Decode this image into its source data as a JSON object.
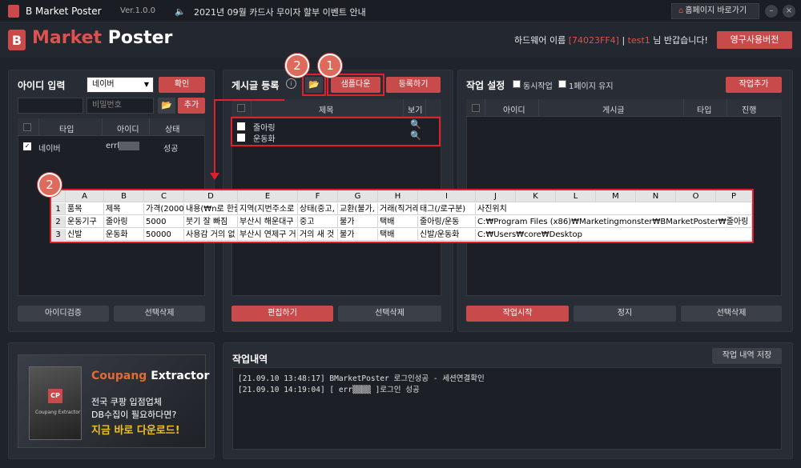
{
  "titlebar": {
    "app_name": "B Market Poster",
    "version": "Ver.1.0.0",
    "notice": "2021년 09월 카드사 무이자 할부 이벤트 안내",
    "home_button": "홈페이지 바로가기"
  },
  "header": {
    "logo_b": "B",
    "logo_market": "Market",
    "logo_poster": "Poster",
    "hw_label": "하드웨어 이름 ",
    "hw_value": "[74023FF4]",
    "sep": " | ",
    "user": "test1",
    "welcome": " 님 반갑습니다!",
    "license_button": "영구사용버전"
  },
  "account": {
    "title": "아이디 입력",
    "site_select": "네이버",
    "confirm_button": "확인",
    "password_placeholder": "비밀번호",
    "add_button": "추가",
    "columns": [
      "타입",
      "아이디",
      "상태"
    ],
    "rows": [
      {
        "type": "네이버",
        "id": "errl",
        "status": "성공"
      }
    ],
    "verify_button": "아이디검증",
    "delete_button": "선택삭제"
  },
  "posts": {
    "title": "게시글 등록",
    "sample_button": "샘플다운",
    "register_button": "등록하기",
    "columns": [
      "제목",
      "보기"
    ],
    "rows": [
      {
        "title": "줄아링"
      },
      {
        "title": "운동화"
      }
    ],
    "edit_button": "편집하기",
    "delete_button": "선택삭제"
  },
  "jobs": {
    "title": "작업 설정",
    "opt_concurrent": "동시작업",
    "opt_keep_page": "1페이지 유지",
    "add_button": "작업추가",
    "columns": [
      "아이디",
      "게시글",
      "타입",
      "진행"
    ],
    "start_button": "작업시작",
    "stop_button": "정지",
    "delete_button": "선택삭제"
  },
  "history": {
    "title": "작업내역",
    "save_button": "작업 내역 저장",
    "lines": [
      "[21.09.10 13:48:17]  BMarketPoster 로그인성공 - 세션연결확인",
      "[21.09.10 14:19:04]  [ err▒▒▒▒ ]로그인 성공"
    ]
  },
  "banner": {
    "brand_coupang": "Coupang",
    "brand_extractor": " Extractor",
    "line1": "전국 쿠팡 입점업체",
    "line2": "DB수집이 필요하다면?",
    "line3": "지금 바로 다운로드!",
    "box_label": "CP",
    "box_sub": "Coupang Extractor"
  },
  "annotations": {
    "badge1": "1",
    "badge2a": "2",
    "badge2b": "2"
  },
  "sheet": {
    "cols": [
      "A",
      "B",
      "C",
      "D",
      "E",
      "F",
      "G",
      "H",
      "I",
      "J",
      "K",
      "L",
      "M",
      "N",
      "O",
      "P"
    ],
    "rows": [
      {
        "n": "1",
        "cells": [
          "품목",
          "제목",
          "가격(2000",
          "내용(₩n로 한줄",
          "지역(지번주소로",
          "상태(중고,",
          "교환(불가,",
          "거래(직거래",
          "태그(/로구분)",
          "사진위치",
          "",
          "",
          "",
          "",
          "",
          ""
        ]
      },
      {
        "n": "2",
        "cells": [
          "운동기구",
          "줄아링",
          "5000",
          "붓기 잘 빠짐",
          "부산시 해운대구",
          "중고",
          "불가",
          "택배",
          "줄아링/운동",
          "C:₩Program Files (x86)₩Marketingmonster₩BMarketPoster₩줄아링",
          "",
          "",
          "",
          "",
          "",
          ""
        ]
      },
      {
        "n": "3",
        "cells": [
          "신발",
          "운동화",
          "50000",
          "사용감 거의 없",
          "부산시 연제구 거",
          "거의 새 것",
          "불가",
          "택배",
          "신발/운동화",
          "C:₩Users₩core₩Desktop",
          "",
          "",
          "",
          "",
          "",
          ""
        ]
      }
    ]
  },
  "colors": {
    "accent": "#c94a4a",
    "highlight": "#e0202a",
    "background": "#1f232b"
  }
}
